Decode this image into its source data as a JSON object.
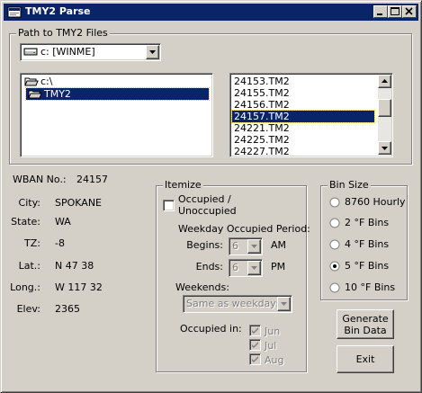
{
  "window": {
    "title": "TMY2 Parse",
    "icons": [
      "app-icon",
      "minimize-icon",
      "maximize-icon",
      "close-icon"
    ]
  },
  "path": {
    "group_label": "Path to TMY2 Files",
    "drive": "c: [WINME]",
    "folders": [
      "c:\\",
      "TMY2"
    ],
    "selected_folder": "TMY2",
    "files": [
      "24153.TM2",
      "24155.TM2",
      "24156.TM2",
      "24157.TM2",
      "24221.TM2",
      "24225.TM2",
      "24227.TM2"
    ],
    "selected_file": "24157.TM2"
  },
  "station": {
    "wban_label": "WBAN No.:",
    "wban": "24157",
    "city_label": "City:",
    "city": "SPOKANE",
    "state_label": "State:",
    "state": "WA",
    "tz_label": "TZ:",
    "tz": "-8",
    "lat_label": "Lat.:",
    "lat": "N 47 38",
    "long_label": "Long.:",
    "long": "W 117 32",
    "elev_label": "Elev:",
    "elev": "2365"
  },
  "itemize": {
    "group_label": "Itemize",
    "occupied_label_1": "Occupied /",
    "occupied_label_2": "Unoccupied",
    "occupied_checked": false,
    "period_label": "Weekday Occupied Period:",
    "begins_label": "Begins:",
    "begins_value": "6",
    "begins_ampm": "AM",
    "ends_label": "Ends:",
    "ends_value": "6",
    "ends_ampm": "PM",
    "weekends_label": "Weekends:",
    "weekends_value": "Same as weekdays",
    "occupied_in_label": "Occupied in:",
    "months": [
      {
        "label": "Jun",
        "checked": true
      },
      {
        "label": "Jul",
        "checked": true
      },
      {
        "label": "Aug",
        "checked": true
      }
    ]
  },
  "binsize": {
    "group_label": "Bin Size",
    "options": [
      "8760 Hourly",
      "2 °F Bins",
      "4 °F Bins",
      "5 °F Bins",
      "10 °F Bins"
    ],
    "selected": "5 °F Bins"
  },
  "buttons": {
    "generate_line1": "Generate",
    "generate_line2": "Bin Data",
    "exit": "Exit"
  },
  "colors": {
    "titlebar": "#0a246a",
    "selection": "#0a246a",
    "face": "#d4d0c8"
  }
}
